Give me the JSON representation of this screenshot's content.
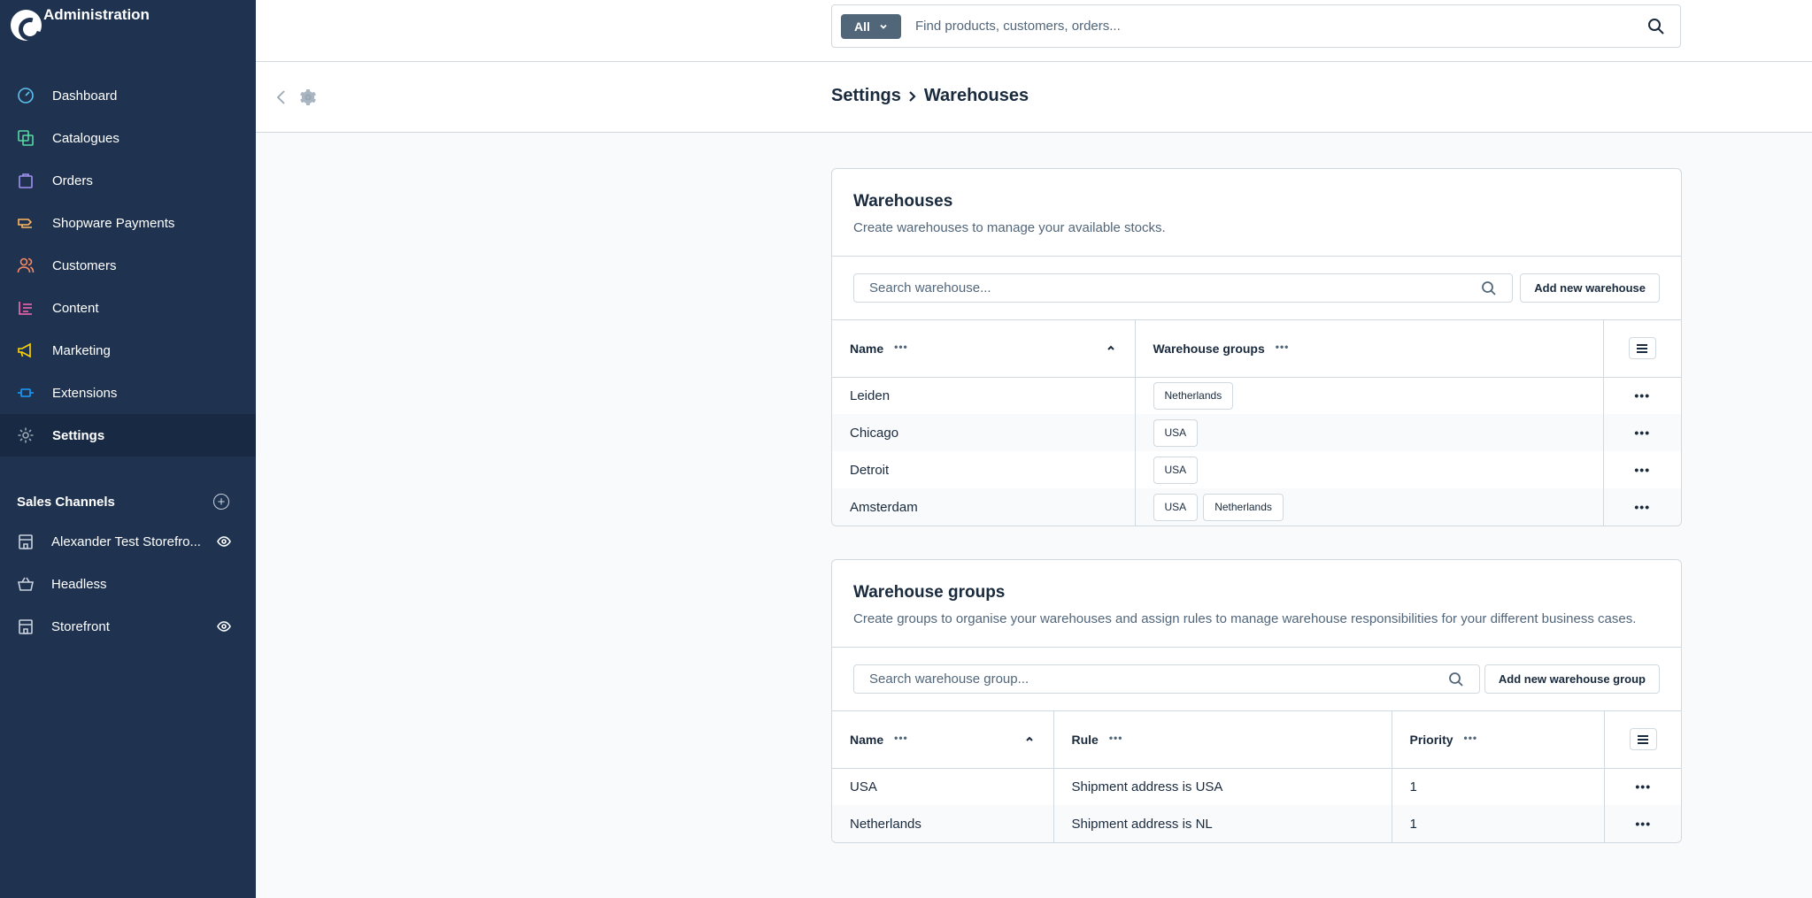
{
  "app": {
    "title": "Administration"
  },
  "sidebar": {
    "items": [
      {
        "label": "Dashboard",
        "icon": "dashboard-icon",
        "color": "#5dc2f0"
      },
      {
        "label": "Catalogues",
        "icon": "catalogues-icon",
        "color": "#57d9a3"
      },
      {
        "label": "Orders",
        "icon": "orders-icon",
        "color": "#a092f0"
      },
      {
        "label": "Shopware Payments",
        "icon": "payments-icon",
        "color": "#ffb75d"
      },
      {
        "label": "Customers",
        "icon": "customers-icon",
        "color": "#f88962"
      },
      {
        "label": "Content",
        "icon": "content-icon",
        "color": "#ff68b4"
      },
      {
        "label": "Marketing",
        "icon": "marketing-icon",
        "color": "#ffd700"
      },
      {
        "label": "Extensions",
        "icon": "extensions-icon",
        "color": "#189eff"
      },
      {
        "label": "Settings",
        "icon": "settings-icon",
        "color": "#9aa8b5",
        "active": true
      }
    ],
    "sales_channels": {
      "title": "Sales Channels",
      "items": [
        {
          "label": "Alexander Test Storefro...",
          "icon": "storefront-icon",
          "visible": true
        },
        {
          "label": "Headless",
          "icon": "headless-icon",
          "visible": false
        },
        {
          "label": "Storefront",
          "icon": "storefront-icon",
          "visible": true
        }
      ]
    }
  },
  "search": {
    "type_label": "All",
    "placeholder": "Find products, customers, orders..."
  },
  "breadcrumb": {
    "parent": "Settings",
    "current": "Warehouses"
  },
  "warehouses": {
    "title": "Warehouses",
    "subtitle": "Create warehouses to manage your available stocks.",
    "search_placeholder": "Search warehouse...",
    "add_button": "Add new warehouse",
    "columns": {
      "name": "Name",
      "groups": "Warehouse groups"
    },
    "rows": [
      {
        "name": "Leiden",
        "groups": [
          "Netherlands"
        ]
      },
      {
        "name": "Chicago",
        "groups": [
          "USA"
        ]
      },
      {
        "name": "Detroit",
        "groups": [
          "USA"
        ]
      },
      {
        "name": "Amsterdam",
        "groups": [
          "USA",
          "Netherlands"
        ]
      }
    ]
  },
  "warehouse_groups": {
    "title": "Warehouse groups",
    "subtitle": "Create groups to organise your warehouses and assign rules to manage warehouse responsibilities for your different business cases.",
    "search_placeholder": "Search warehouse group...",
    "add_button": "Add new warehouse group",
    "columns": {
      "name": "Name",
      "rule": "Rule",
      "priority": "Priority"
    },
    "rows": [
      {
        "name": "USA",
        "rule": "Shipment address is USA",
        "priority": "1"
      },
      {
        "name": "Netherlands",
        "rule": "Shipment address is NL",
        "priority": "1"
      }
    ]
  },
  "colors": {
    "sidebar_bg": "#1f3350",
    "sidebar_active": "#182a43",
    "text": "#1a2a3d",
    "muted": "#52667a",
    "border": "#d1d9e0"
  }
}
